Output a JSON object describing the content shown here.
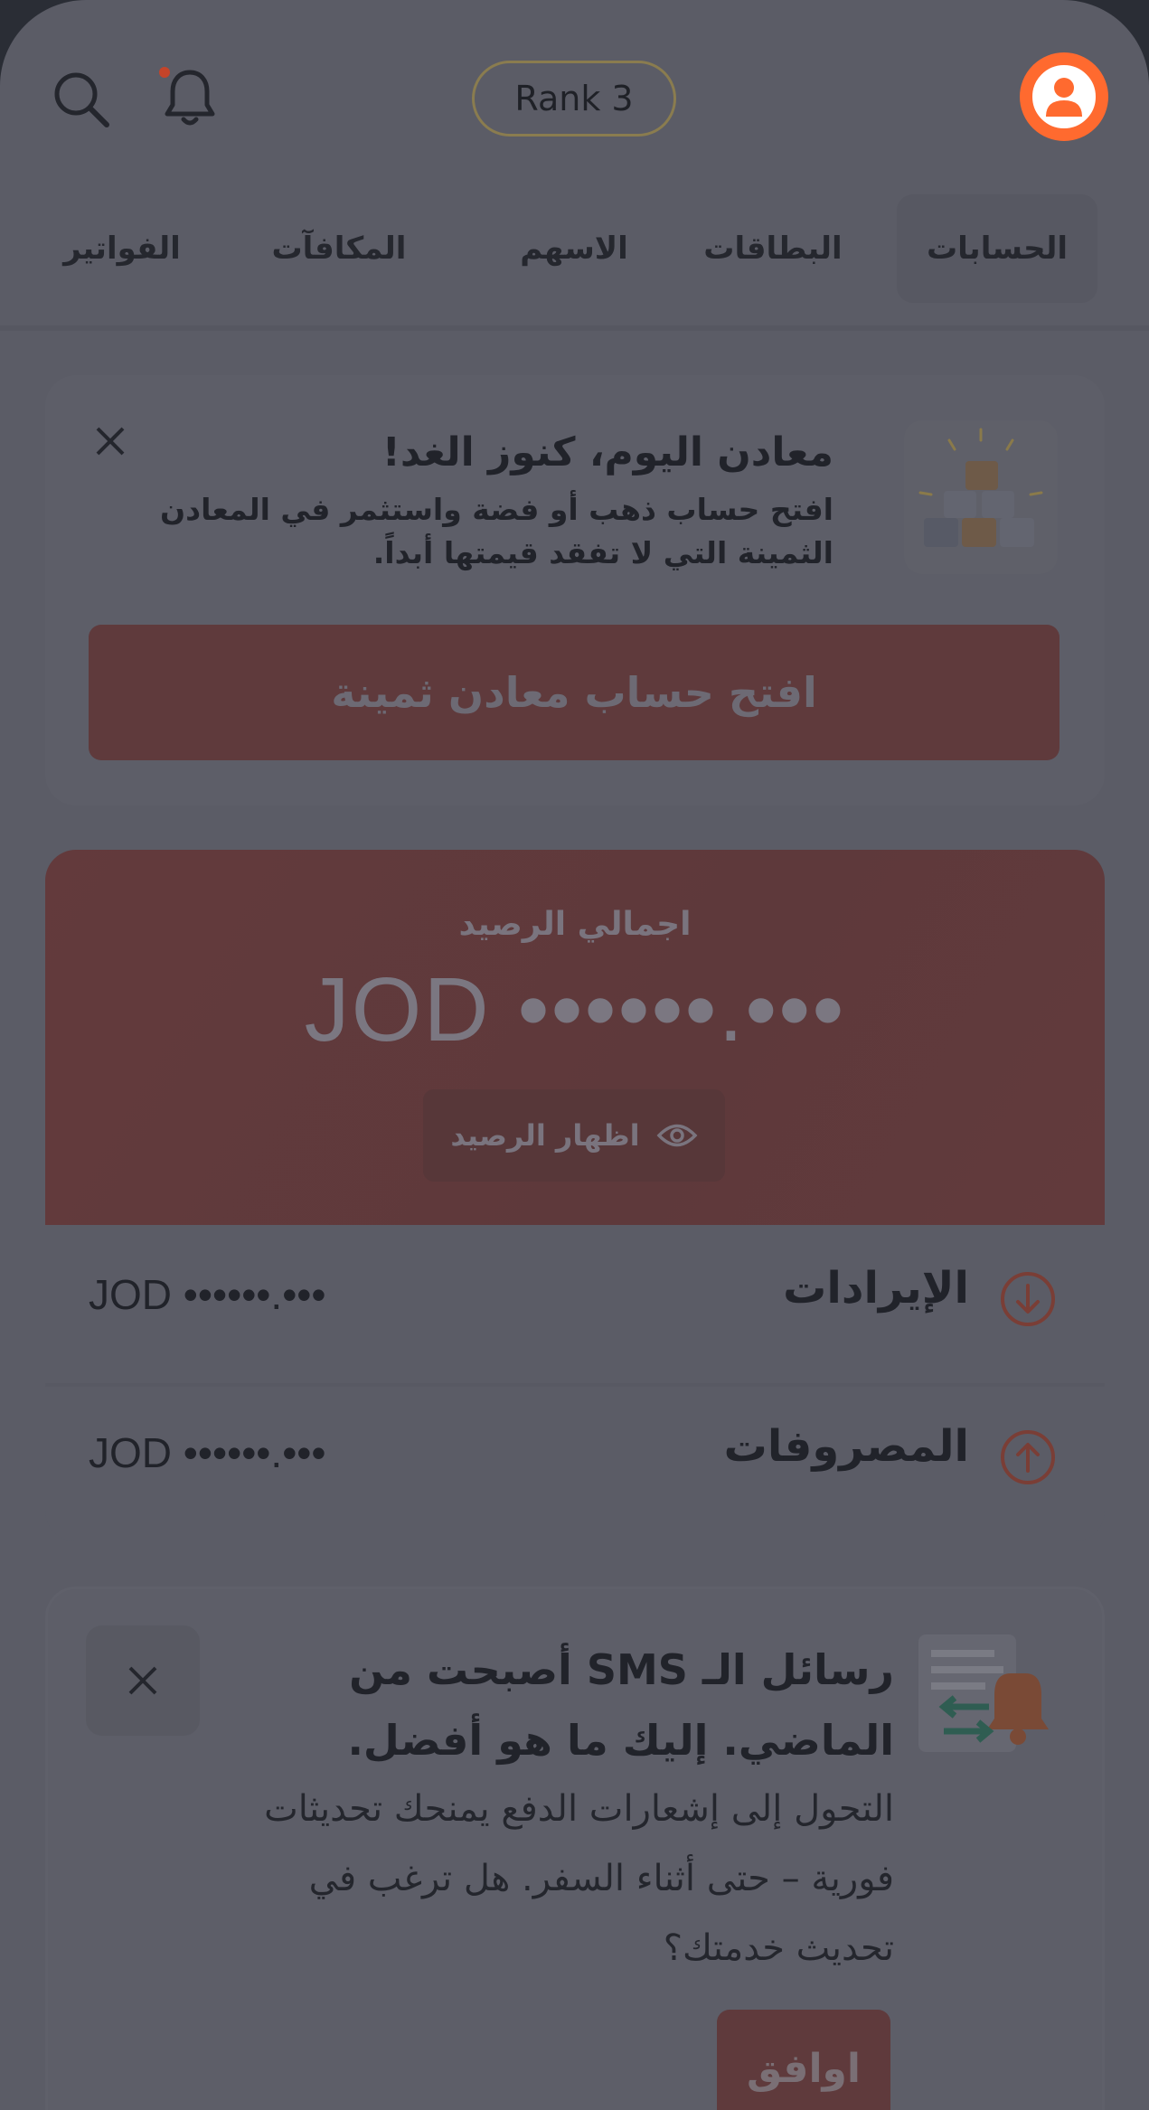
{
  "header": {
    "rank_label": "Rank 3",
    "icons": {
      "search": "search-icon",
      "notifications": "bell-icon",
      "profile": "user-avatar-icon"
    },
    "colors": {
      "accent": "#ff6a2f",
      "notification_dot": "#c4442a"
    }
  },
  "tabs": [
    {
      "label": "الحسابات",
      "active": true
    },
    {
      "label": "البطاقات",
      "active": false
    },
    {
      "label": "الاسهم",
      "active": false
    },
    {
      "label": "المكافآت",
      "active": false
    },
    {
      "label": "الفواتير",
      "active": false
    }
  ],
  "metals_banner": {
    "title": "معادن اليوم، كنوز الغد!",
    "description": "افتح حساب ذهب أو فضة واستثمر في المعادن الثمينة التي لا تفقد قيمتها أبداً.",
    "cta_label": "افتح حساب معادن ثمينة",
    "icons": {
      "close": "close-icon",
      "thumbnail": "gold-bars-icon"
    }
  },
  "balance": {
    "label": "اجمالي الرصيد",
    "amount": "JOD ••••••.•••",
    "show_label": "اظهار الرصيد",
    "icons": {
      "show": "eye-icon"
    }
  },
  "income": {
    "label": "الإيرادات",
    "amount": "JOD ••••••.•••",
    "icon": "arrow-down-circle-icon"
  },
  "expenses": {
    "label": "المصروفات",
    "amount": "JOD ••••••.•••",
    "icon": "arrow-up-circle-icon"
  },
  "sms_banner": {
    "title": "رسائل الـ SMS أصبحت من الماضي. إليك ما هو أفضل.",
    "description": "التحول إلى إشعارات الدفع يمنحك تحديثات فورية – حتى أثناء السفر. هل ترغب في تحديث خدمتك؟",
    "agree_label": "اوافق",
    "icons": {
      "close": "close-icon",
      "thumbnail": "push-notification-icon"
    }
  }
}
